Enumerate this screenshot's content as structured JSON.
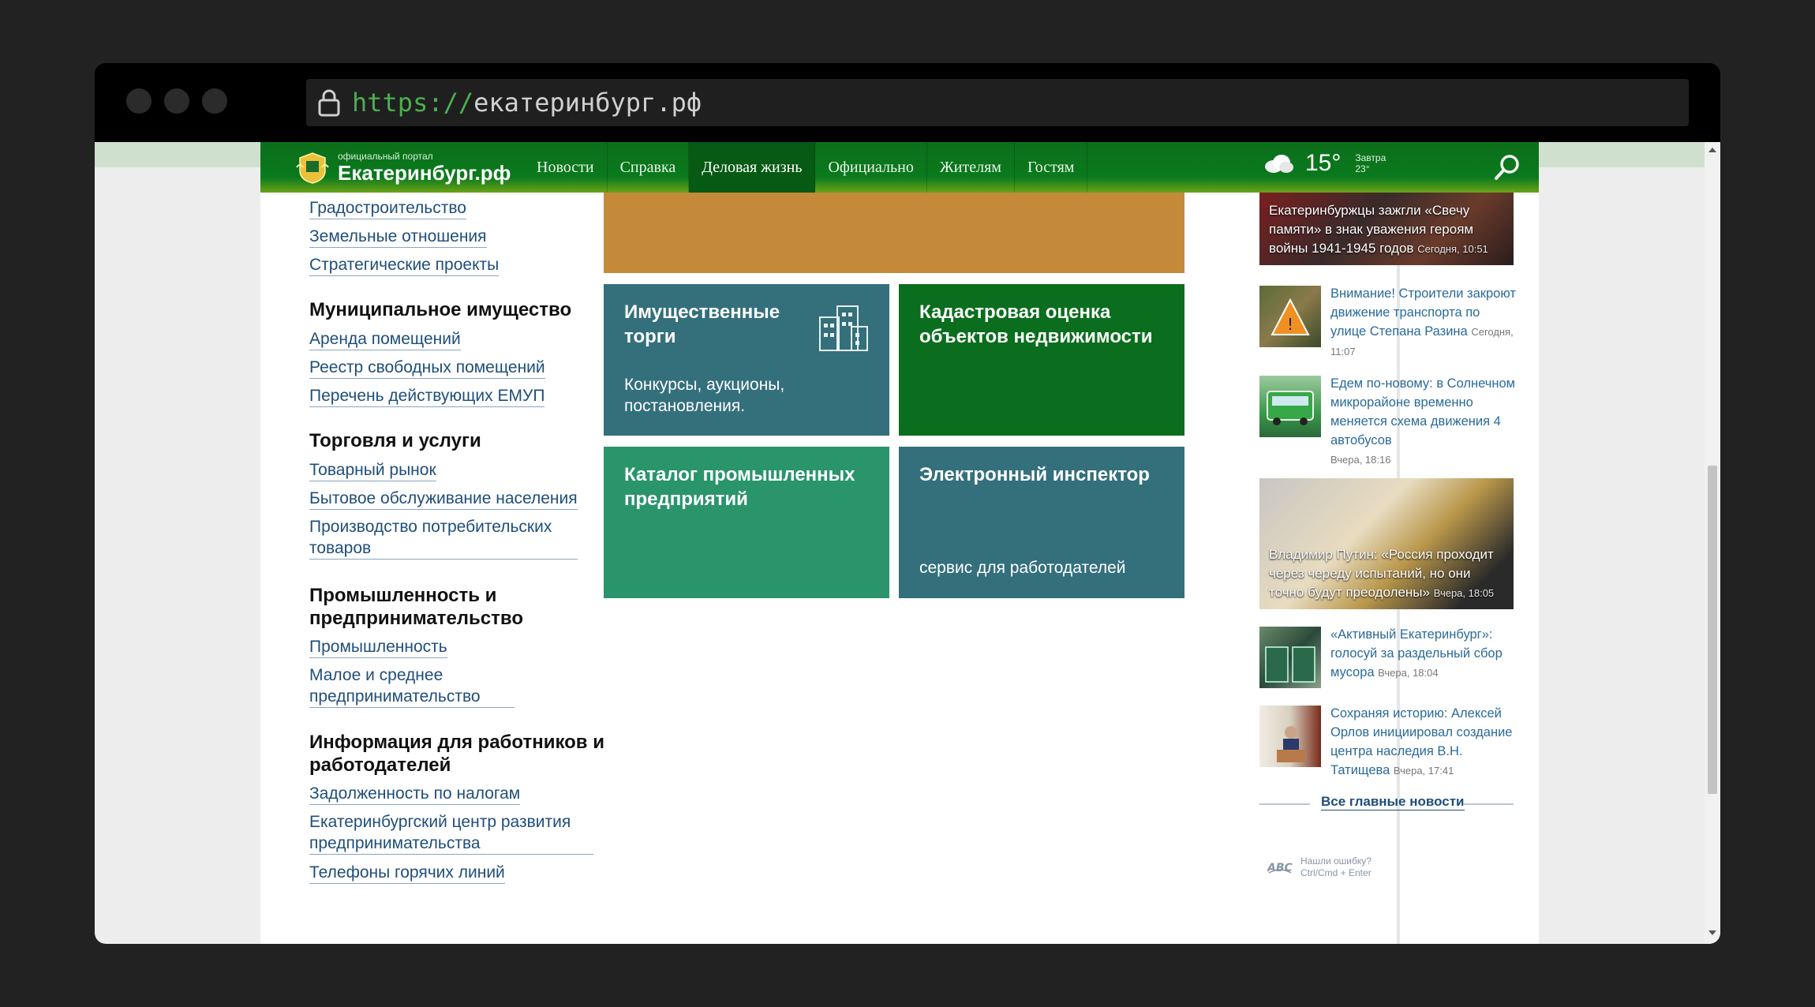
{
  "browser": {
    "url_scheme": "https://",
    "url_host": "екатеринбург.рф"
  },
  "portal": {
    "tagline": "официальный портал",
    "name": "Екатеринбург.рф"
  },
  "nav": {
    "items": [
      "Новости",
      "Справка",
      "Деловая жизнь",
      "Официально",
      "Жителям",
      "Гостям"
    ],
    "active": "Деловая жизнь"
  },
  "weather": {
    "temp": "15°",
    "tomorrow_label": "Завтра",
    "tomorrow_temp": "23°",
    "icon": "cloud-icon"
  },
  "sidebar": {
    "top_links": [
      "Градостроительство",
      "Земельные отношения",
      "Стратегические проекты"
    ],
    "sections": [
      {
        "title": "Муниципальное имущество",
        "links": [
          "Аренда помещений",
          "Реестр свободных помещений",
          "Перечень действующих ЕМУП"
        ]
      },
      {
        "title": "Торговля и услуги",
        "links": [
          "Товарный рынок",
          "Бытовое обслуживание населения",
          "Производство потребительских товаров"
        ]
      },
      {
        "title": "Промышленность и предпринимательство",
        "links": [
          "Промышленность",
          "Малое и среднее предпринимательство"
        ]
      },
      {
        "title": "Информация для работников и работодателей",
        "links": [
          "Задолженность по налогам",
          "Екатеринбургский центр развития предпринимательства",
          "Телефоны горячих линий"
        ]
      }
    ]
  },
  "tiles": [
    {
      "title": "Имущественные торги",
      "subtitle": "Конкурсы, аукционы, постановления.",
      "color": "#346f7c"
    },
    {
      "title": "Кадастровая оценка объектов недвижимости",
      "subtitle": "",
      "color": "#0a6e1e"
    },
    {
      "title": "Каталог промышленных предприятий",
      "subtitle": "",
      "color": "#2a946b"
    },
    {
      "title": "Электронный инспектор",
      "subtitle": "сервис для работодателей",
      "color": "#346f7c"
    }
  ],
  "banner_color": "#c48a3a",
  "news": [
    {
      "text": "Екатеринбуржцы зажгли «Свечу памяти» в знак уважения героям войны 1941-1945 годов",
      "time": "Сегодня, 10:51",
      "big": true
    },
    {
      "text": "Внимание! Строители закроют движение транспорта по улице Степана Разина",
      "time": "Сегодня, 11:07"
    },
    {
      "text": "Едем по-новому: в Солнечном микрорайоне временно меняется схема движения 4 автобусов",
      "time": "Вчера, 18:16"
    },
    {
      "text": "Владимир Путин: «Россия проходит через череду испытаний, но они точно будут преодолены»",
      "time": "Вчера, 18:05",
      "big": true
    },
    {
      "text": "«Активный Екатеринбург»: голосуй за раздельный сбор мусора",
      "time": "Вчера, 18:04"
    },
    {
      "text": "Сохраняя историю: Алексей Орлов инициировал создание центра наследия В.Н. Татищева",
      "time": "Вчера, 17:41"
    }
  ],
  "all_news_label": "Все главные новости",
  "typo": {
    "line1": "Нашли ошибку?",
    "line2": "Ctrl/Cmd + Enter"
  }
}
